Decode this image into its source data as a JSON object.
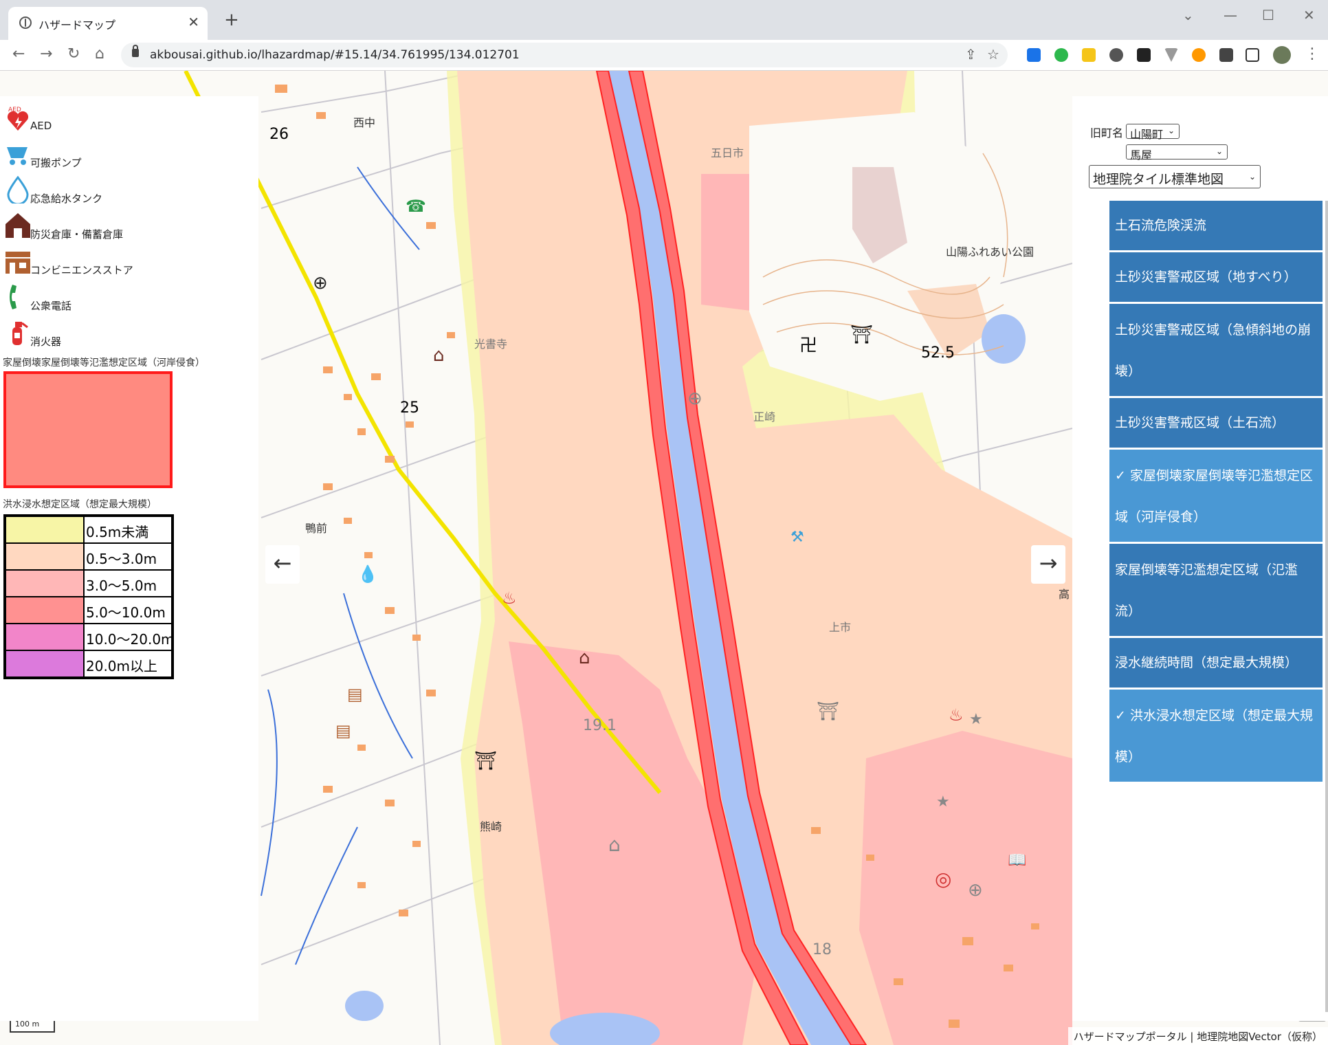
{
  "browser": {
    "tab_title": "ハザードマップ",
    "url": "akbousai.github.io/lhazardmap/#15.14/34.761995/134.012701"
  },
  "legend": {
    "poi": [
      {
        "label": "AED",
        "icon": "aed-icon"
      },
      {
        "label": "可搬ポンプ",
        "icon": "pump-icon"
      },
      {
        "label": "応急給水タンク",
        "icon": "water-tank-icon"
      },
      {
        "label": "防災倉庫・備蓄倉庫",
        "icon": "storehouse-icon"
      },
      {
        "label": "コンビニエンスストア",
        "icon": "convenience-store-icon"
      },
      {
        "label": "公衆電話",
        "icon": "phone-icon"
      },
      {
        "label": "消火器",
        "icon": "extinguisher-icon"
      }
    ],
    "erosion_title": "家屋倒壊家屋倒壊等氾濫想定区域（河岸侵食）",
    "flood_title": "洪水浸水想定区域（想定最大規模）",
    "flood_levels": [
      {
        "label": "0.5m未満",
        "color": "#f7f5a6"
      },
      {
        "label": "0.5～3.0m",
        "color": "#ffd8c0"
      },
      {
        "label": "3.0～5.0m",
        "color": "#ffb7b7"
      },
      {
        "label": "5.0～10.0m",
        "color": "#ff9191"
      },
      {
        "label": "10.0～20.0m",
        "color": "#f285c9"
      },
      {
        "label": "20.0m以上",
        "color": "#dc7adc"
      }
    ]
  },
  "controls": {
    "town_label": "旧町名",
    "town_select": "山陽町",
    "district_select": "馬屋",
    "basemap_select": "地理院タイル標準地図"
  },
  "layers": [
    {
      "label": "土石流危険渓流",
      "active": false
    },
    {
      "label": "土砂災害警戒区域（地すべり）",
      "active": false
    },
    {
      "label": "土砂災害警戒区域（急傾斜地の崩壊）",
      "active": false
    },
    {
      "label": "土砂災害警戒区域（土石流）",
      "active": false
    },
    {
      "label": "✓ 家屋倒壊家屋倒壊等氾濫想定区域（河岸侵食）",
      "active": true
    },
    {
      "label": "家屋倒壊等氾濫想定区域（氾濫流）",
      "active": false
    },
    {
      "label": "浸水継続時間（想定最大規模）",
      "active": false
    },
    {
      "label": "✓ 洪水浸水想定区域（想定最大規模）",
      "active": true
    }
  ],
  "map": {
    "place_names": [
      "西中",
      "五日市",
      "山陽ふれあい公園",
      "光書寺",
      "正崎",
      "鴨前",
      "上市",
      "熊崎",
      "高"
    ],
    "elevations": [
      "26",
      "25",
      "52.5",
      "19.1",
      "18"
    ],
    "zoom_in": "+",
    "zoom_out": "−",
    "compass": "▲",
    "prev_arrow": "←",
    "next_arrow": "→",
    "scale": "100 m",
    "attribution": "ハザードマップポータル | 地理院地図Vector（仮称）"
  },
  "colors": {
    "river": "#a9c3f5",
    "erosion": "#ff6f6f",
    "panel_button": "#3579b6",
    "panel_button_active": "#4a98d4"
  }
}
